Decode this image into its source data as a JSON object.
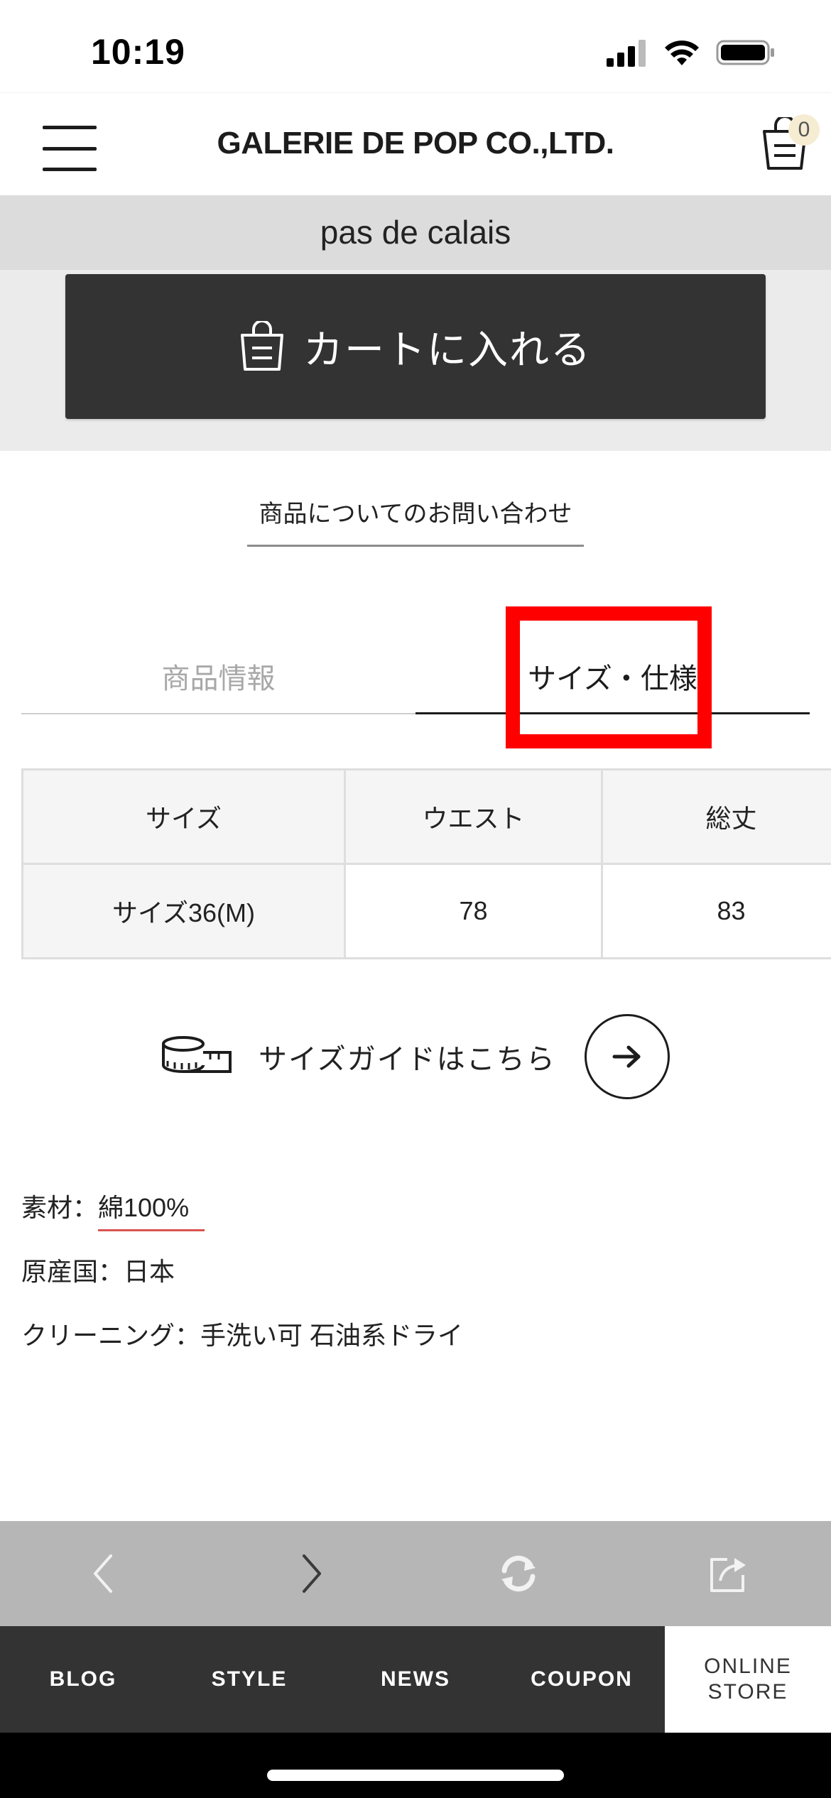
{
  "status_bar": {
    "time": "10:19"
  },
  "header": {
    "brand": "GALERIE DE POP CO.,LTD.",
    "cart_count": "0"
  },
  "shop_name": "pas de calais",
  "add_to_cart": {
    "label": "カートに入れる"
  },
  "inquiry_link": "商品についてのお問い合わせ",
  "tabs": [
    {
      "label": "商品情報",
      "active": false
    },
    {
      "label": "サイズ・仕様",
      "active": true
    }
  ],
  "size_table": {
    "headers": [
      "サイズ",
      "ウエスト",
      "総丈"
    ],
    "rows": [
      [
        "サイズ36(M)",
        "78",
        "83"
      ]
    ]
  },
  "size_guide": {
    "label": "サイズガイドはこちら"
  },
  "specs": {
    "material_label": "素材：",
    "material_value": "綿100%",
    "origin": "原産国：日本",
    "cleaning": "クリーニング：手洗い可 石油系ドライ"
  },
  "bottom_nav": [
    "BLOG",
    "STYLE",
    "NEWS",
    "COUPON",
    "ONLINE\nSTORE"
  ],
  "colors": {
    "dark": "#333333",
    "highlight": "#ff0000",
    "band": "#dcdcdc"
  }
}
